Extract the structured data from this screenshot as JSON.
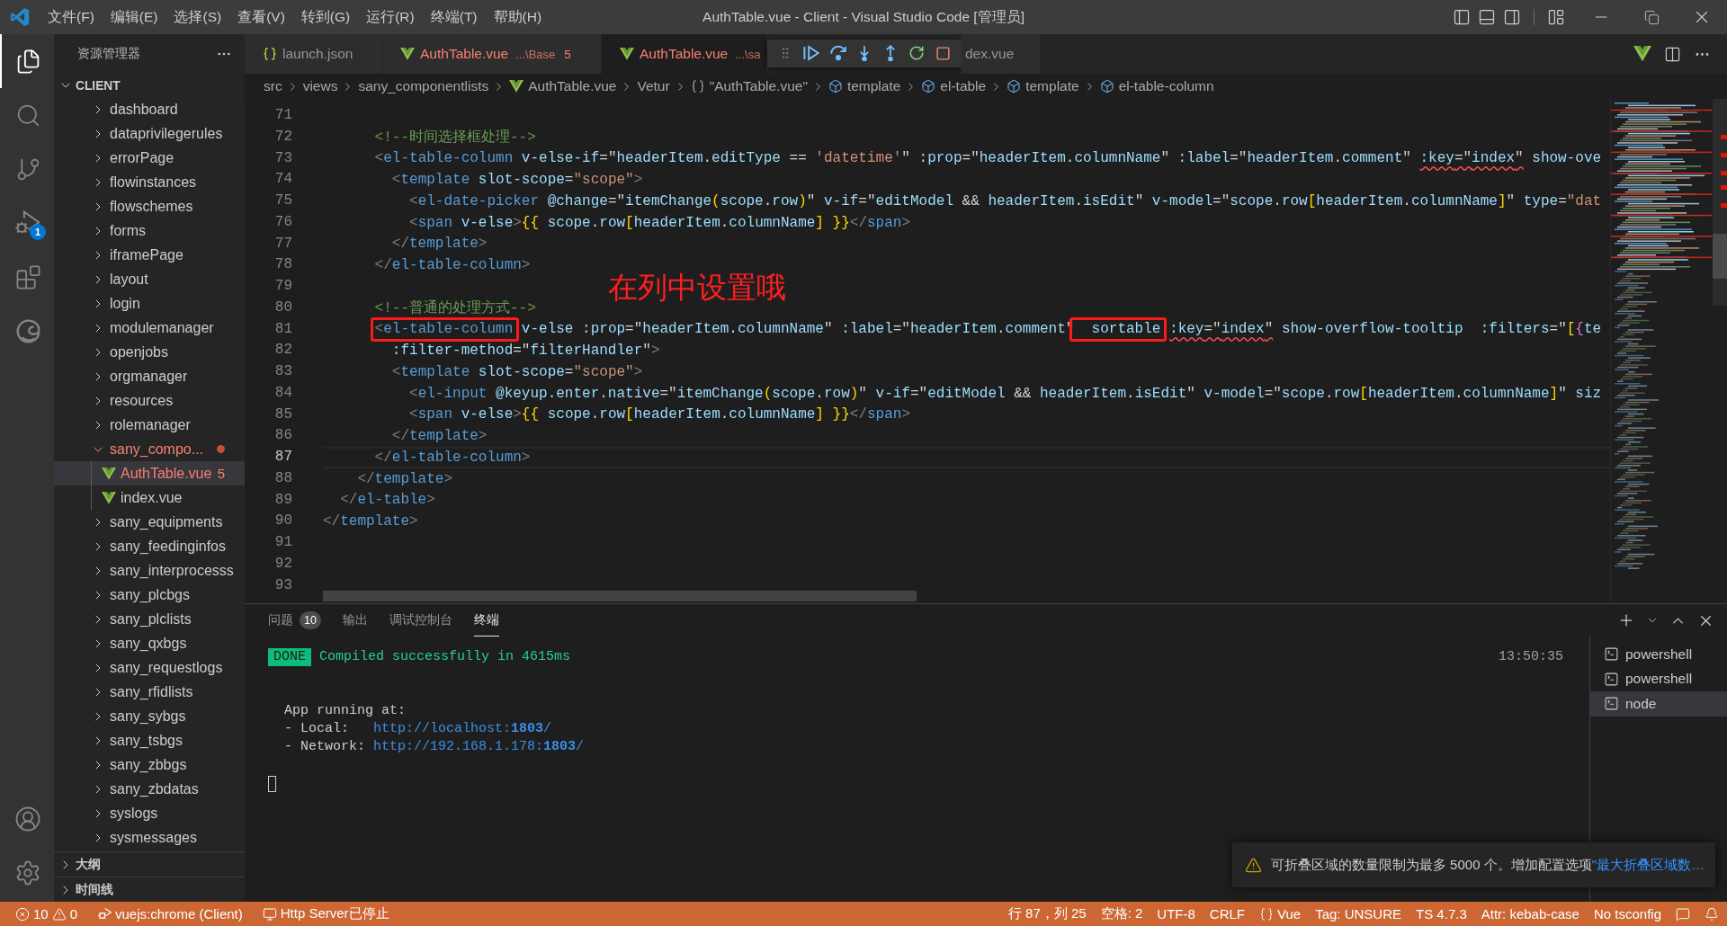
{
  "window": {
    "title": "AuthTable.vue - Client - Visual Studio Code [管理员]"
  },
  "menu": [
    "文件(F)",
    "编辑(E)",
    "选择(S)",
    "查看(V)",
    "转到(G)",
    "运行(R)",
    "终端(T)",
    "帮助(H)"
  ],
  "activity_bar": {
    "top": [
      {
        "kind": "files",
        "selected": true
      },
      {
        "kind": "search",
        "selected": false
      },
      {
        "kind": "source-control",
        "selected": false
      },
      {
        "kind": "run-debug",
        "selected": false,
        "badge": "1"
      },
      {
        "kind": "extensions",
        "selected": false
      },
      {
        "kind": "swirl",
        "selected": false
      }
    ],
    "bottom": [
      {
        "kind": "account"
      },
      {
        "kind": "settings"
      }
    ]
  },
  "sidebar": {
    "title": "资源管理器",
    "section": {
      "title": "CLIENT",
      "expanded": true
    },
    "tree": [
      {
        "kind": "folder",
        "name": "dashboard",
        "expanded": false,
        "selected": false,
        "error": false
      },
      {
        "kind": "folder",
        "name": "dataprivilegerules",
        "expanded": false,
        "selected": false,
        "error": false
      },
      {
        "kind": "folder",
        "name": "errorPage",
        "expanded": false,
        "selected": false,
        "error": false
      },
      {
        "kind": "folder",
        "name": "flowinstances",
        "expanded": false,
        "selected": false,
        "error": false
      },
      {
        "kind": "folder",
        "name": "flowschemes",
        "expanded": false,
        "selected": false,
        "error": false
      },
      {
        "kind": "folder",
        "name": "forms",
        "expanded": false,
        "selected": false,
        "error": false
      },
      {
        "kind": "folder",
        "name": "iframePage",
        "expanded": false,
        "selected": false,
        "error": false
      },
      {
        "kind": "folder",
        "name": "layout",
        "expanded": false,
        "selected": false,
        "error": false
      },
      {
        "kind": "folder",
        "name": "login",
        "expanded": false,
        "selected": false,
        "error": false
      },
      {
        "kind": "folder",
        "name": "modulemanager",
        "expanded": false,
        "selected": false,
        "error": false
      },
      {
        "kind": "folder",
        "name": "openjobs",
        "expanded": false,
        "selected": false,
        "error": false
      },
      {
        "kind": "folder",
        "name": "orgmanager",
        "expanded": false,
        "selected": false,
        "error": false
      },
      {
        "kind": "folder",
        "name": "resources",
        "expanded": false,
        "selected": false,
        "error": false
      },
      {
        "kind": "folder",
        "name": "rolemanager",
        "expanded": false,
        "selected": false,
        "error": false
      },
      {
        "kind": "folder",
        "name": "sany_compo...",
        "expanded": true,
        "selected": false,
        "error": true,
        "children": [
          {
            "kind": "file",
            "name": "AuthTable.vue",
            "selected": true,
            "error": true,
            "badge": "5"
          },
          {
            "kind": "file",
            "name": "index.vue",
            "selected": false,
            "error": false
          }
        ]
      },
      {
        "kind": "folder",
        "name": "sany_equipments",
        "expanded": false,
        "selected": false,
        "error": false
      },
      {
        "kind": "folder",
        "name": "sany_feedinginfos",
        "expanded": false,
        "selected": false,
        "error": false
      },
      {
        "kind": "folder",
        "name": "sany_interprocesss",
        "expanded": false,
        "selected": false,
        "error": false
      },
      {
        "kind": "folder",
        "name": "sany_plcbgs",
        "expanded": false,
        "selected": false,
        "error": false
      },
      {
        "kind": "folder",
        "name": "sany_plclists",
        "expanded": false,
        "selected": false,
        "error": false
      },
      {
        "kind": "folder",
        "name": "sany_qxbgs",
        "expanded": false,
        "selected": false,
        "error": false
      },
      {
        "kind": "folder",
        "name": "sany_requestlogs",
        "expanded": false,
        "selected": false,
        "error": false
      },
      {
        "kind": "folder",
        "name": "sany_rfidlists",
        "expanded": false,
        "selected": false,
        "error": false
      },
      {
        "kind": "folder",
        "name": "sany_sybgs",
        "expanded": false,
        "selected": false,
        "error": false
      },
      {
        "kind": "folder",
        "name": "sany_tsbgs",
        "expanded": false,
        "selected": false,
        "error": false
      },
      {
        "kind": "folder",
        "name": "sany_zbbgs",
        "expanded": false,
        "selected": false,
        "error": false
      },
      {
        "kind": "folder",
        "name": "sany_zbdatas",
        "expanded": false,
        "selected": false,
        "error": false
      },
      {
        "kind": "folder",
        "name": "syslogs",
        "expanded": false,
        "selected": false,
        "error": false
      },
      {
        "kind": "folder",
        "name": "sysmessages",
        "expanded": false,
        "selected": false,
        "error": false
      }
    ],
    "panels": [
      {
        "title": "大纲",
        "expanded": false
      },
      {
        "title": "时间线",
        "expanded": false
      }
    ]
  },
  "tabs": [
    {
      "kind": "json",
      "name": "launch.json",
      "selected": false,
      "error": false
    },
    {
      "kind": "vue",
      "name": "AuthTable.vue",
      "path": "...\\Base",
      "badge": "5",
      "selected": false,
      "error": true
    },
    {
      "kind": "vue",
      "name": "AuthTable.vue",
      "path": "...\\sa",
      "selected": true,
      "error": true
    },
    {
      "kind": "text",
      "name": "dex.vue",
      "selected": false,
      "error": false
    }
  ],
  "breadcrumb": [
    {
      "kind": "text",
      "label": "src"
    },
    {
      "kind": "text",
      "label": "views"
    },
    {
      "kind": "text",
      "label": "sany_componentlists"
    },
    {
      "kind": "vue",
      "label": "AuthTable.vue"
    },
    {
      "kind": "text",
      "label": "Vetur"
    },
    {
      "kind": "braces",
      "label": "\"AuthTable.vue\""
    },
    {
      "kind": "element",
      "label": "template"
    },
    {
      "kind": "element",
      "label": "el-table"
    },
    {
      "kind": "element",
      "label": "template"
    },
    {
      "kind": "element",
      "label": "el-table-column"
    }
  ],
  "editor": {
    "note": "在列中设置哦",
    "lines": [
      {
        "number": "71",
        "current": false
      },
      {
        "number": "72",
        "current": false,
        "code": [
          {
            "text": "      <!--时间选择框处理-->",
            "error": false,
            "boxed": false
          }
        ]
      },
      {
        "number": "73",
        "current": false,
        "code": [
          {
            "text": "      <el-table-column v-else-if=\"headerItem.editType == 'datetime'\" :prop=\"headerItem.columnName\" :label=\"headerItem.comment\" ",
            "error": false,
            "boxed": false
          },
          {
            "text": ":key=\"index\"",
            "error": true,
            "boxed": false
          },
          {
            "text": " show-ove",
            "error": false,
            "boxed": false
          }
        ]
      },
      {
        "number": "74",
        "current": false,
        "code": [
          {
            "text": "        <template slot-scope=\"scope\">",
            "error": false,
            "boxed": false
          }
        ]
      },
      {
        "number": "75",
        "current": false,
        "code": [
          {
            "text": "          <el-date-picker @change=\"itemChange(scope.row)\" v-if=\"editModel && headerItem.isEdit\" v-model=\"scope.row[headerItem.columnName]\" type=\"dat",
            "error": false,
            "boxed": false
          }
        ]
      },
      {
        "number": "76",
        "current": false,
        "code": [
          {
            "text": "          <span v-else>{{ scope.row[headerItem.columnName] }}</span>",
            "error": false,
            "boxed": false
          }
        ]
      },
      {
        "number": "77",
        "current": false,
        "code": [
          {
            "text": "        </template>",
            "error": false,
            "boxed": false
          }
        ]
      },
      {
        "number": "78",
        "current": false,
        "code": [
          {
            "text": "      </el-table-column>",
            "error": false,
            "boxed": false
          }
        ]
      },
      {
        "number": "79",
        "current": false
      },
      {
        "number": "80",
        "current": false,
        "code": [
          {
            "text": "      <!--普通的处理方式-->",
            "error": false,
            "boxed": false
          }
        ]
      },
      {
        "number": "81",
        "current": false,
        "code": [
          {
            "text": "      <el-table-column",
            "error": false,
            "boxed": true
          },
          {
            "text": " v-else :prop=\"headerItem.columnName\" :label=\"headerItem.comment\"",
            "error": false,
            "boxed": false
          },
          {
            "text": "  sortable ",
            "error": false,
            "boxed": true
          },
          {
            "text": ":key=\"index\"",
            "error": true,
            "boxed": false
          },
          {
            "text": " show-overflow-tooltip  :filters=\"[{te",
            "error": false,
            "boxed": false
          }
        ]
      },
      {
        "number": "82",
        "current": false,
        "code": [
          {
            "text": "        :filter-method=\"filterHandler\">",
            "error": false,
            "boxed": false
          }
        ]
      },
      {
        "number": "83",
        "current": false,
        "code": [
          {
            "text": "        <template slot-scope=\"scope\">",
            "error": false,
            "boxed": false
          }
        ]
      },
      {
        "number": "84",
        "current": false,
        "code": [
          {
            "text": "          <el-input @keyup.enter.native=\"itemChange(scope.row)\" v-if=\"editModel && headerItem.isEdit\" v-model=\"scope.row[headerItem.columnName]\" siz",
            "error": false,
            "boxed": false
          }
        ]
      },
      {
        "number": "85",
        "current": false,
        "code": [
          {
            "text": "          <span v-else>{{ scope.row[headerItem.columnName] }}</span>",
            "error": false,
            "boxed": false
          }
        ]
      },
      {
        "number": "86",
        "current": false,
        "code": [
          {
            "text": "        </template>",
            "error": false,
            "boxed": false
          }
        ]
      },
      {
        "number": "87",
        "current": true,
        "code": [
          {
            "text": "      </el-table-column>",
            "error": false,
            "boxed": false
          }
        ]
      },
      {
        "number": "88",
        "current": false,
        "code": [
          {
            "text": "    </template>",
            "error": false,
            "boxed": false
          }
        ]
      },
      {
        "number": "89",
        "current": false,
        "code": [
          {
            "text": "  </el-table>",
            "error": false,
            "boxed": false
          }
        ]
      },
      {
        "number": "90",
        "current": false,
        "code": [
          {
            "text": "</template>",
            "error": false,
            "boxed": false
          }
        ]
      },
      {
        "number": "91",
        "current": false
      },
      {
        "number": "92",
        "current": false
      },
      {
        "number": "93",
        "current": false
      }
    ]
  },
  "panel": {
    "tabs": [
      {
        "label": "问题",
        "badge": "10",
        "selected": false
      },
      {
        "label": "输出",
        "selected": false
      },
      {
        "label": "调试控制台",
        "selected": false
      },
      {
        "label": "终端",
        "selected": true
      }
    ],
    "terminal": {
      "status": {
        "badge": "DONE",
        "message": "Compiled successfully in 4615ms",
        "time": "13:50:35"
      },
      "lines": [
        {
          "text": "App running at:"
        },
        {
          "text": "- Local:",
          "url": "http://localhost:**1803**/"
        },
        {
          "text": "- Network:",
          "url": "http://192.168.1.178:**1803**/"
        }
      ],
      "cursor": true
    },
    "terminals": [
      {
        "label": "powershell",
        "selected": false
      },
      {
        "label": "powershell",
        "selected": false
      },
      {
        "label": "node",
        "selected": true
      }
    ]
  },
  "notification": {
    "message": "可折叠区域的数量限制为最多 5000 个。增加配置选项",
    "link": "\"最大折叠区域数…"
  },
  "status_bar": {
    "left": [
      {
        "kind": "problems",
        "errors": "10",
        "warnings": "0"
      },
      {
        "kind": "debug",
        "label": "vuejs:chrome (Client)"
      },
      {
        "kind": "server",
        "label": "Http Server已停止"
      }
    ],
    "right": [
      {
        "kind": "text",
        "label": "行 87，列 25"
      },
      {
        "kind": "text",
        "label": "空格: 2"
      },
      {
        "kind": "text",
        "label": "UTF-8"
      },
      {
        "kind": "text",
        "label": "CRLF"
      },
      {
        "kind": "braces",
        "label": "Vue"
      },
      {
        "kind": "text",
        "label": "Tag: UNSURE"
      },
      {
        "kind": "text",
        "label": "TS 4.7.3"
      },
      {
        "kind": "text",
        "label": "Attr: kebab-case"
      },
      {
        "kind": "text",
        "label": "No tsconfig"
      },
      {
        "kind": "feedback"
      },
      {
        "kind": "bell"
      }
    ]
  }
}
